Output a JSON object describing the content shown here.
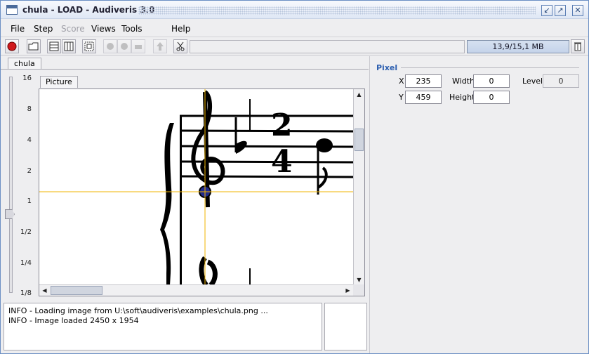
{
  "window": {
    "title": "chula - LOAD - Audiveris 3.0"
  },
  "menu": [
    "File",
    "Step",
    "Score",
    "Views",
    "Tools",
    "Help"
  ],
  "memory": "13,9/15,1 MB",
  "tabs": {
    "sheet": "chula",
    "picture": "Picture"
  },
  "zoom_labels": [
    "16",
    "8",
    "4",
    "2",
    "1",
    "1/2",
    "1/4",
    "1/8"
  ],
  "pixel": {
    "title": "Pixel",
    "x_label": "X",
    "x_value": "235",
    "y_label": "Y",
    "y_value": "459",
    "width_label": "Width",
    "width_value": "0",
    "height_label": "Height",
    "height_value": "0",
    "level_label": "Level",
    "level_value": "0"
  },
  "log": [
    "INFO - Loading image from U:\\soft\\audiveris\\examples\\chula.png ...",
    "INFO - Image loaded 2450 x 1954"
  ],
  "colors": {
    "accent": "#2d5fb0",
    "crosshair": "#f0b400",
    "memory_bg": "#c5d3ea"
  }
}
